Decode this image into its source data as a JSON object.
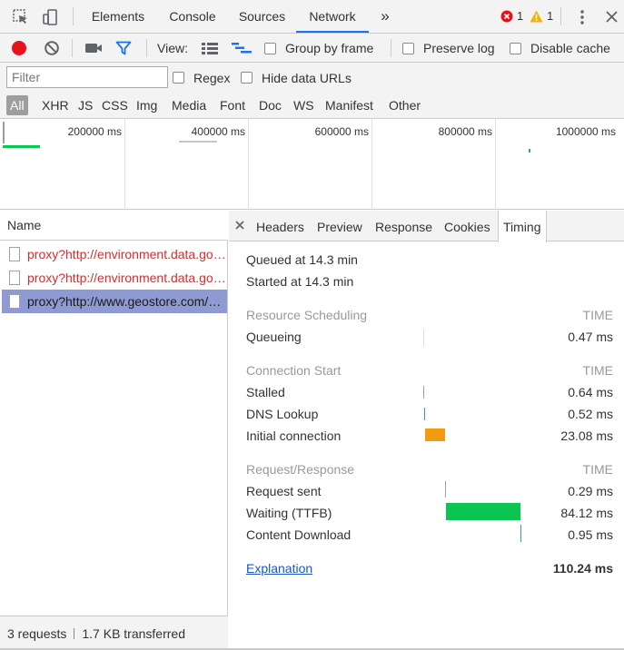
{
  "tabs": [
    {
      "label": "Elements"
    },
    {
      "label": "Console"
    },
    {
      "label": "Sources"
    },
    {
      "label": "Network"
    }
  ],
  "more_tabs_glyph": "»",
  "errors_count": "1",
  "warnings_count": "1",
  "toolbar": {
    "view_label": "View:",
    "group_by_frame": "Group by frame",
    "preserve_log": "Preserve log",
    "disable_cache": "Disable cache"
  },
  "filter": {
    "placeholder": "Filter",
    "regex": "Regex",
    "hide_data_urls": "Hide data URLs"
  },
  "types": [
    "All",
    "XHR",
    "JS",
    "CSS",
    "Img",
    "Media",
    "Font",
    "Doc",
    "WS",
    "Manifest",
    "Other"
  ],
  "overview": {
    "labels": [
      "200000 ms",
      "400000 ms",
      "600000 ms",
      "800000 ms",
      "1000000 ms"
    ]
  },
  "requests_header": "Name",
  "requests": [
    {
      "name": "proxy?http://environment.data.gov.uk",
      "status": "error"
    },
    {
      "name": "proxy?http://environment.data.gov.uk",
      "status": "error"
    },
    {
      "name": "proxy?http://www.geostore.com/OGC",
      "status": "selected"
    }
  ],
  "status": {
    "requests": "3 requests",
    "transferred": "1.7 KB transferred"
  },
  "subtabs": [
    "Headers",
    "Preview",
    "Response",
    "Cookies",
    "Timing"
  ],
  "timing": {
    "queued": "Queued at 14.3 min",
    "started": "Started at 14.3 min",
    "time_header": "TIME",
    "sections": [
      {
        "title": "Resource Scheduling",
        "rows": [
          {
            "label": "Queueing",
            "value": "0.47 ms"
          }
        ]
      },
      {
        "title": "Connection Start",
        "rows": [
          {
            "label": "Stalled",
            "value": "0.64 ms"
          },
          {
            "label": "DNS Lookup",
            "value": "0.52 ms"
          },
          {
            "label": "Initial connection",
            "value": "23.08 ms"
          }
        ]
      },
      {
        "title": "Request/Response",
        "rows": [
          {
            "label": "Request sent",
            "value": "0.29 ms"
          },
          {
            "label": "Waiting (TTFB)",
            "value": "84.12 ms"
          },
          {
            "label": "Content Download",
            "value": "0.95 ms"
          }
        ]
      }
    ],
    "explanation": "Explanation",
    "total": "110.24 ms"
  },
  "colors": {
    "accent": "#1a73e8",
    "record": "#e8121a",
    "error": "#d32f2f",
    "selected_row": "#8f9ad2",
    "connection_bar": "#f39c12",
    "waiting_bar": "#0cc451",
    "download_bar": "#2aa0c4"
  },
  "icons": [
    "inspect-icon",
    "device-icon",
    "error-icon",
    "warning-icon",
    "kebab-menu-icon",
    "close-icon",
    "record-icon",
    "clear-icon",
    "camera-icon",
    "filter-icon",
    "list-view-icon",
    "waterfall-view-icon",
    "file-icon"
  ]
}
